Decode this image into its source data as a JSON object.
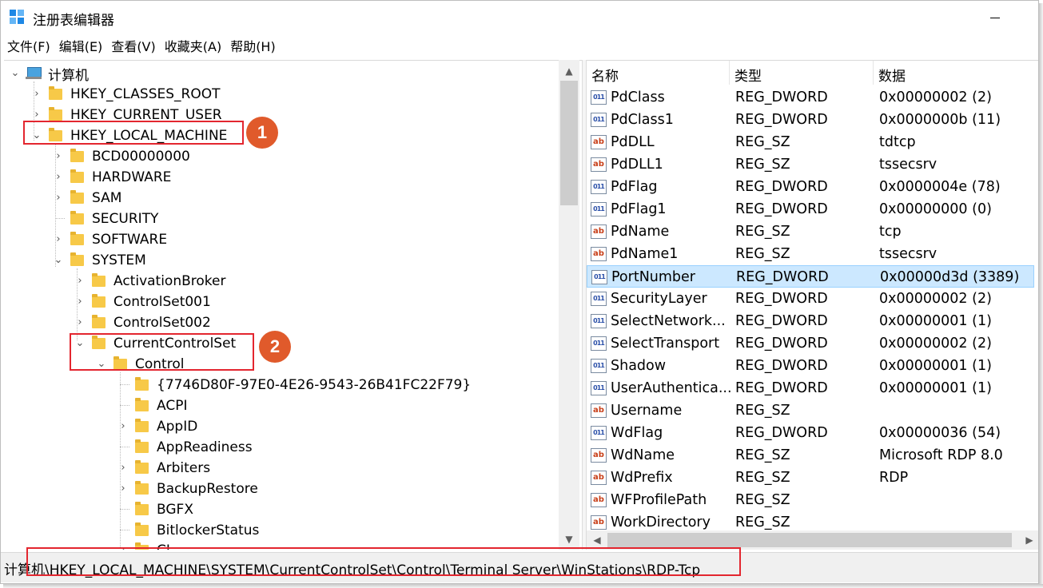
{
  "window": {
    "title": "注册表编辑器",
    "minimize_label": "—"
  },
  "menu": [
    "文件(F)",
    "编辑(E)",
    "查看(V)",
    "收藏夹(A)",
    "帮助(H)"
  ],
  "tree": {
    "root": "计算机",
    "hives": [
      "HKEY_CLASSES_ROOT",
      "HKEY_CURRENT_USER",
      "HKEY_LOCAL_MACHINE"
    ],
    "hklm_children": [
      "BCD00000000",
      "HARDWARE",
      "SAM",
      "SECURITY",
      "SOFTWARE",
      "SYSTEM"
    ],
    "system_children": [
      "ActivationBroker",
      "ControlSet001",
      "ControlSet002",
      "CurrentControlSet"
    ],
    "ccs_children": [
      "Control"
    ],
    "control_children": [
      "{7746D80F-97E0-4E26-9543-26B41FC22F79}",
      "ACPI",
      "AppID",
      "AppReadiness",
      "Arbiters",
      "BackupRestore",
      "BGFX",
      "BitlockerStatus",
      "CI"
    ]
  },
  "list": {
    "headers": [
      "名称",
      "类型",
      "数据"
    ],
    "rows": [
      {
        "name": "PdClass",
        "type": "REG_DWORD",
        "data": "0x00000002 (2)",
        "icon": "dword-icon"
      },
      {
        "name": "PdClass1",
        "type": "REG_DWORD",
        "data": "0x0000000b (11)",
        "icon": "dword-icon"
      },
      {
        "name": "PdDLL",
        "type": "REG_SZ",
        "data": "tdtcp",
        "icon": "string-icon"
      },
      {
        "name": "PdDLL1",
        "type": "REG_SZ",
        "data": "tssecsrv",
        "icon": "string-icon"
      },
      {
        "name": "PdFlag",
        "type": "REG_DWORD",
        "data": "0x0000004e (78)",
        "icon": "dword-icon"
      },
      {
        "name": "PdFlag1",
        "type": "REG_DWORD",
        "data": "0x00000000 (0)",
        "icon": "dword-icon"
      },
      {
        "name": "PdName",
        "type": "REG_SZ",
        "data": "tcp",
        "icon": "string-icon"
      },
      {
        "name": "PdName1",
        "type": "REG_SZ",
        "data": "tssecsrv",
        "icon": "string-icon"
      },
      {
        "name": "PortNumber",
        "type": "REG_DWORD",
        "data": "0x00000d3d (3389)",
        "icon": "dword-icon",
        "selected": true
      },
      {
        "name": "SecurityLayer",
        "type": "REG_DWORD",
        "data": "0x00000002 (2)",
        "icon": "dword-icon"
      },
      {
        "name": "SelectNetwork...",
        "type": "REG_DWORD",
        "data": "0x00000001 (1)",
        "icon": "dword-icon"
      },
      {
        "name": "SelectTransport",
        "type": "REG_DWORD",
        "data": "0x00000002 (2)",
        "icon": "dword-icon"
      },
      {
        "name": "Shadow",
        "type": "REG_DWORD",
        "data": "0x00000001 (1)",
        "icon": "dword-icon"
      },
      {
        "name": "UserAuthentica...",
        "type": "REG_DWORD",
        "data": "0x00000001 (1)",
        "icon": "dword-icon"
      },
      {
        "name": "Username",
        "type": "REG_SZ",
        "data": "",
        "icon": "string-icon"
      },
      {
        "name": "WdFlag",
        "type": "REG_DWORD",
        "data": "0x00000036 (54)",
        "icon": "dword-icon"
      },
      {
        "name": "WdName",
        "type": "REG_SZ",
        "data": "Microsoft RDP 8.0",
        "icon": "string-icon"
      },
      {
        "name": "WdPrefix",
        "type": "REG_SZ",
        "data": "RDP",
        "icon": "string-icon"
      },
      {
        "name": "WFProfilePath",
        "type": "REG_SZ",
        "data": "",
        "icon": "string-icon"
      },
      {
        "name": "WorkDirectory",
        "type": "REG_SZ",
        "data": "",
        "icon": "string-icon"
      }
    ]
  },
  "status": {
    "path": "计算机\\HKEY_LOCAL_MACHINE\\SYSTEM\\CurrentControlSet\\Control\\Terminal Server\\WinStations\\RDP-Tcp"
  },
  "annotations": {
    "badge1": "1",
    "badge2": "2",
    "color": "#e3262f",
    "badge_color": "#e05a2b"
  },
  "colors": {
    "selection_bg": "#cce8ff",
    "folder": "#f7c948"
  }
}
